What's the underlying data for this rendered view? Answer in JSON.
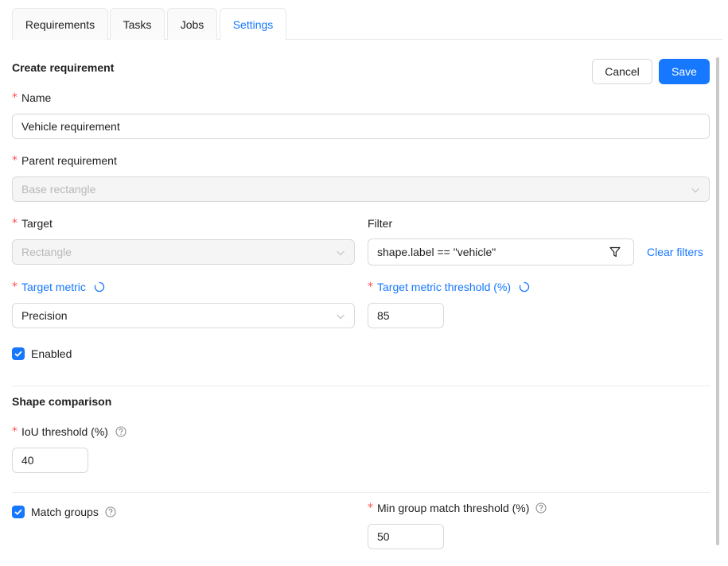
{
  "tabs": [
    {
      "label": "Requirements",
      "active": false
    },
    {
      "label": "Tasks",
      "active": false
    },
    {
      "label": "Jobs",
      "active": false
    },
    {
      "label": "Settings",
      "active": true
    }
  ],
  "form": {
    "title": "Create requirement",
    "cancel_label": "Cancel",
    "save_label": "Save",
    "name": {
      "label": "Name",
      "value": "Vehicle requirement"
    },
    "parent": {
      "label": "Parent requirement",
      "value": "Base rectangle"
    },
    "target": {
      "label": "Target",
      "value": "Rectangle"
    },
    "filter": {
      "label": "Filter",
      "value": "shape.label == \"vehicle\"",
      "clear_label": "Clear filters"
    },
    "target_metric": {
      "label": "Target metric",
      "value": "Precision"
    },
    "threshold": {
      "label": "Target metric threshold (%)",
      "value": "85"
    },
    "enabled": {
      "label": "Enabled",
      "checked": true
    }
  },
  "shape_comparison": {
    "title": "Shape comparison",
    "iou": {
      "label": "IoU threshold (%)",
      "value": "40"
    },
    "match_groups": {
      "label": "Match groups",
      "checked": true
    },
    "min_group": {
      "label": "Min group match threshold (%)",
      "value": "50"
    }
  },
  "colors": {
    "accent": "#1677ff",
    "required": "#ff4d4f"
  }
}
